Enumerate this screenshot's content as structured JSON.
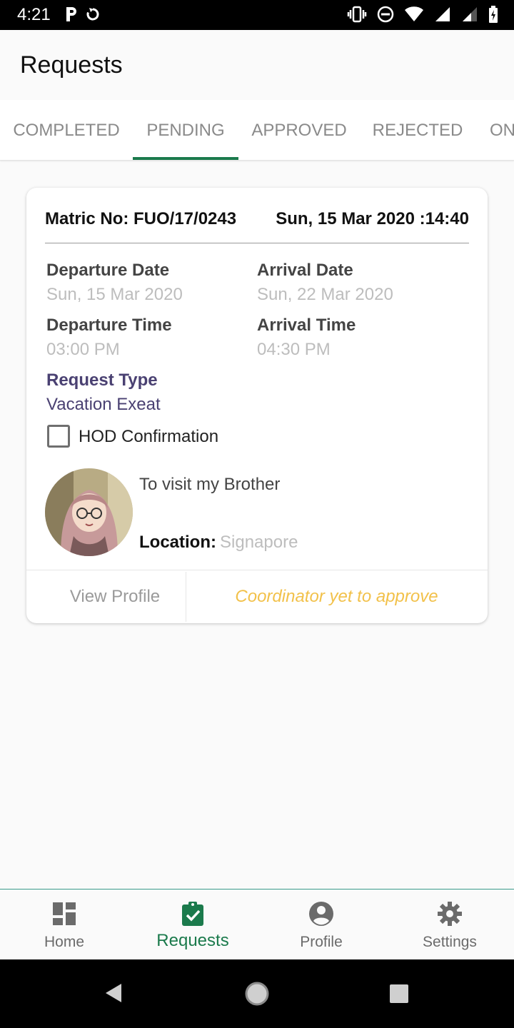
{
  "status_bar": {
    "time": "4:21",
    "left_icons": [
      "parking-icon",
      "sync-icon"
    ],
    "right_icons": [
      "vibrate-icon",
      "do-not-disturb-icon",
      "wifi-icon",
      "signal-icon",
      "signal-2-icon",
      "battery-charging-icon"
    ]
  },
  "app_bar": {
    "title": "Requests"
  },
  "tabs": [
    {
      "label": "COMPLETED",
      "active": false
    },
    {
      "label": "PENDING",
      "active": true
    },
    {
      "label": "APPROVED",
      "active": false
    },
    {
      "label": "REJECTED",
      "active": false
    },
    {
      "label": "ON",
      "active": false
    }
  ],
  "request_card": {
    "matric": "Matric No: FUO/17/0243",
    "request_datetime": "Sun, 15 Mar 2020 :14:40",
    "departure_date_label": "Departure Date",
    "departure_date": "Sun, 15 Mar 2020",
    "arrival_date_label": "Arrival Date",
    "arrival_date": "Sun, 22 Mar 2020",
    "departure_time_label": "Departure Time",
    "departure_time": "03:00 PM",
    "arrival_time_label": "Arrival Time",
    "arrival_time": "04:30 PM",
    "request_type_label": "Request Type",
    "request_type": "Vacation Exeat",
    "hod_confirmation_label": "HOD Confirmation",
    "hod_confirmed": false,
    "reason": "To visit my Brother",
    "location_label": "Location:",
    "location": "Signapore",
    "view_profile_label": "View Profile",
    "status_text": "Coordinator yet to approve"
  },
  "bottom_nav": {
    "items": [
      {
        "label": "Home",
        "icon": "dashboard-icon",
        "active": false
      },
      {
        "label": "Requests",
        "icon": "clipboard-check-icon",
        "active": true
      },
      {
        "label": "Profile",
        "icon": "account-circle-icon",
        "active": false
      },
      {
        "label": "Settings",
        "icon": "gear-icon",
        "active": false
      }
    ]
  },
  "colors": {
    "accent": "#1b7a4c",
    "request_type": "#4a4172",
    "pending_status": "#f2c14a",
    "muted_value": "#bdbdbd"
  }
}
